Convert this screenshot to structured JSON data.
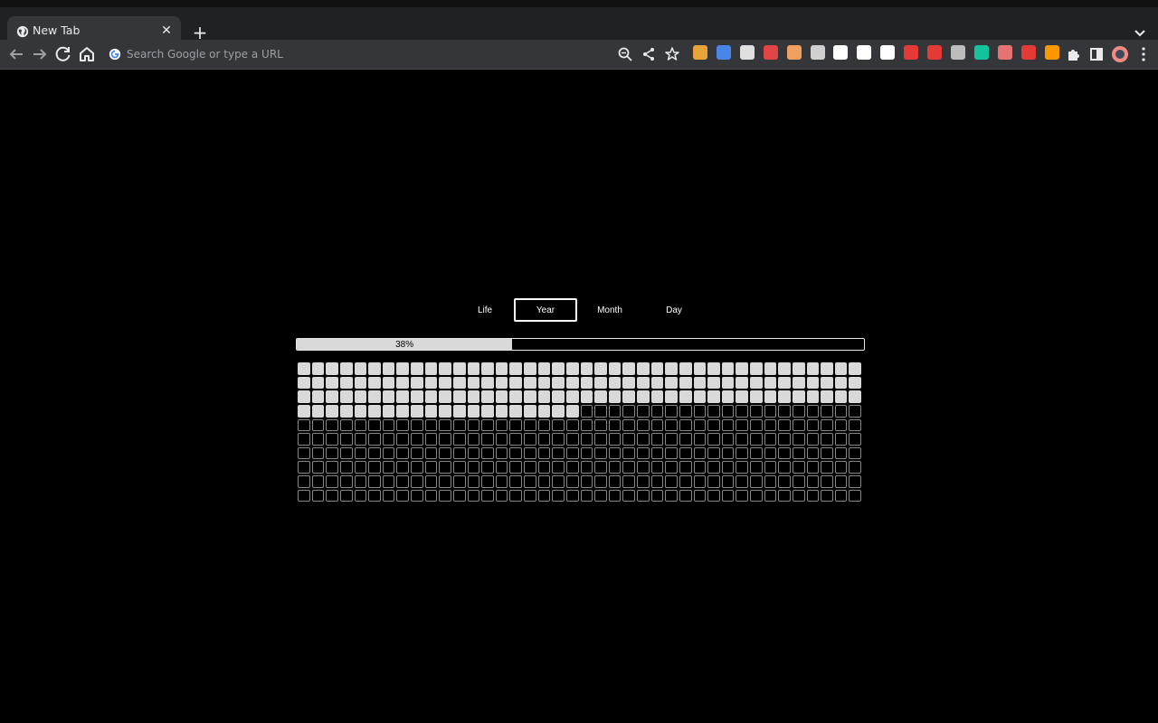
{
  "browser": {
    "tab_title": "New Tab",
    "new_tab_symbol": "+",
    "close_symbol": "✕",
    "omnibox_placeholder": "Search Google or type a URL",
    "extensions": [
      {
        "name": "puzzle-color-extension-icon",
        "color": "#e8a33a"
      },
      {
        "name": "blue-extension-icon",
        "color": "#4a86e8"
      },
      {
        "name": "white-card-extension-icon",
        "color": "#e0e0e0"
      },
      {
        "name": "shield-extension-icon",
        "color": "#e04444"
      },
      {
        "name": "orange-extension-icon",
        "color": "#f0a060"
      },
      {
        "name": "screen-extension-icon",
        "color": "#d0d0d0"
      },
      {
        "name": "instapaper-extension-icon",
        "color": "#ffffff"
      },
      {
        "name": "r-extension-icon",
        "color": "#ffffff"
      },
      {
        "name": "notion-extension-icon",
        "color": "#ffffff"
      },
      {
        "name": "red-play-extension-icon",
        "color": "#e53935"
      },
      {
        "name": "stop-hand-extension-icon",
        "color": "#e53935"
      },
      {
        "name": "gray-extension-icon",
        "color": "#bdbdbd"
      },
      {
        "name": "grammarly-extension-icon",
        "color": "#15c39a"
      },
      {
        "name": "arc-extension-icon",
        "color": "#e57373"
      },
      {
        "name": "red-dots-extension-icon",
        "color": "#e53935"
      },
      {
        "name": "firefox-like-extension-icon",
        "color": "#ff9800"
      }
    ]
  },
  "app": {
    "tabs": [
      {
        "label": "Life",
        "active": false
      },
      {
        "label": "Year",
        "active": true
      },
      {
        "label": "Month",
        "active": false
      },
      {
        "label": "Day",
        "active": false
      }
    ],
    "progress": {
      "percent": 38,
      "label": "38%"
    },
    "grid": {
      "columns": 40,
      "rows": 10,
      "filled": 140
    }
  }
}
